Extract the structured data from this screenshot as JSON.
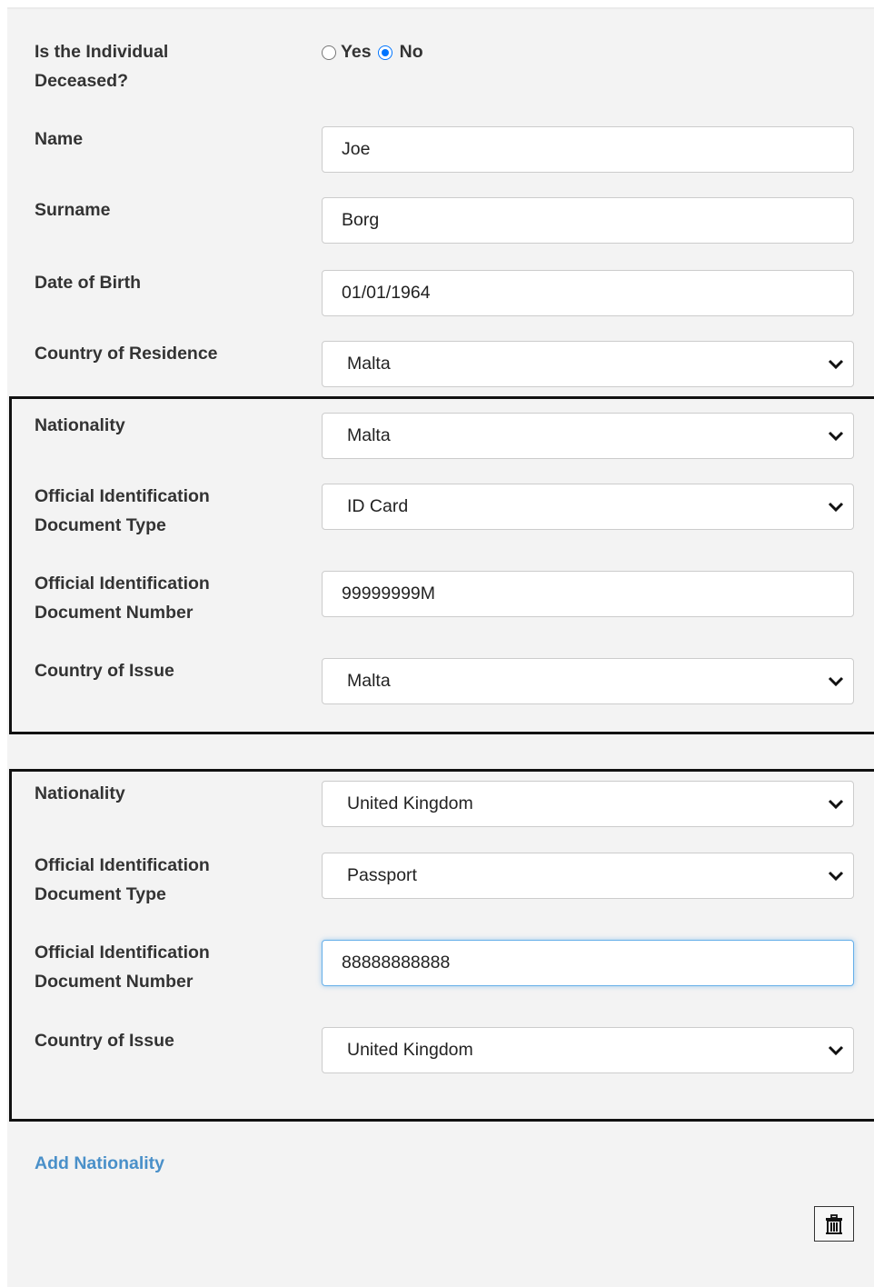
{
  "deceased": {
    "label_line1": "Is the Individual",
    "label_line2": "Deceased?",
    "yes_label": "Yes",
    "no_label": "No",
    "selected": "No"
  },
  "name": {
    "label": "Name",
    "value": "Joe"
  },
  "surname": {
    "label": "Surname",
    "value": "Borg"
  },
  "dob": {
    "label": "Date of Birth",
    "value": "01/01/1964"
  },
  "residence": {
    "label": "Country of Residence",
    "value": "Malta"
  },
  "nationalities": [
    {
      "nationality_label": "Nationality",
      "nationality_value": "Malta",
      "doc_type_label_line1": "Official Identification",
      "doc_type_label_line2": "Document Type",
      "doc_type_value": "ID Card",
      "doc_number_label_line1": "Official Identification",
      "doc_number_label_line2": "Document Number",
      "doc_number_value": "99999999M",
      "issue_label": "Country of Issue",
      "issue_value": "Malta"
    },
    {
      "nationality_label": "Nationality",
      "nationality_value": "United Kingdom",
      "doc_type_label_line1": "Official Identification",
      "doc_type_label_line2": "Document Type",
      "doc_type_value": "Passport",
      "doc_number_label_line1": "Official Identification",
      "doc_number_label_line2": "Document Number",
      "doc_number_value": "88888888888",
      "issue_label": "Country of Issue",
      "issue_value": "United Kingdom"
    }
  ],
  "add_nationality_label": "Add Nationality",
  "delete_icon": "trash-icon",
  "colors": {
    "panel_bg": "#f3f3f3",
    "link": "#4a90c9",
    "radio_accent": "#0075ff",
    "focus_border": "#66afe9"
  }
}
